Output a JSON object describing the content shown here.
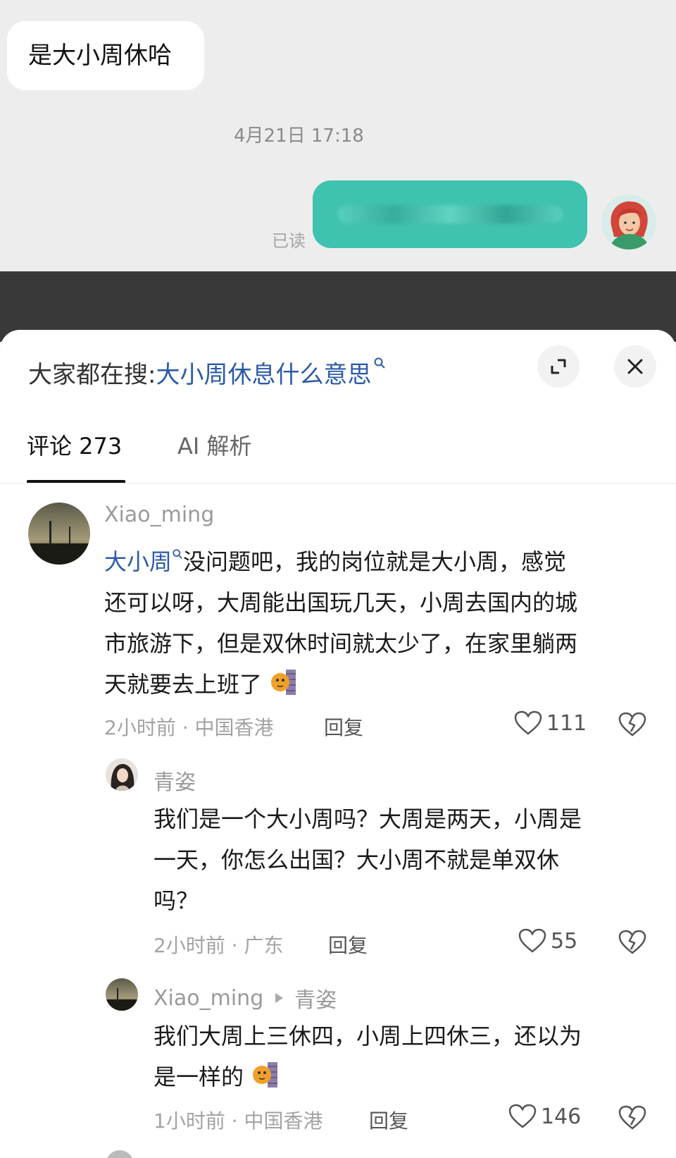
{
  "chat": {
    "incoming_message": "是大小周休哈",
    "timestamp": "4月21日 17:18",
    "read_status": "已读",
    "colors": {
      "outgoing_bubble": "#3fc2b0",
      "background": "#ededed"
    }
  },
  "sheet": {
    "search_prefix": "大家都在搜:",
    "search_query": "大小周休息什么意思",
    "expand_icon": "expand-icon",
    "close_icon": "close-icon"
  },
  "tabs": [
    {
      "label": "评论 273",
      "active": true
    },
    {
      "label": "AI 解析",
      "active": false
    }
  ],
  "comments": [
    {
      "user": "Xiao_ming",
      "link_text": "大小周",
      "lines": [
        "没问题吧，我的岗位就是大小周，感觉",
        "还可以呀，大周能出国玩几天，小周去国内的城",
        "市旅游下，但是双休时间就太少了，在家里躺两",
        "天就要去上班了"
      ],
      "time_location": "2小时前 · 中国香港",
      "reply_label": "回复",
      "likes": "111"
    },
    {
      "user": "青姿",
      "lines": [
        "我们是一个大小周吗？大周是两天，小周是",
        "一天，你怎么出国？大小周不就是单双休",
        "吗？"
      ],
      "time_location": "2小时前 · 广东",
      "reply_label": "回复",
      "likes": "55"
    },
    {
      "user": "Xiao_ming",
      "reply_to": "青姿",
      "lines": [
        "我们大周上三休四，小周上四休三，还以为",
        "是一样的"
      ],
      "time_location": "1小时前 · 中国香港",
      "reply_label": "回复",
      "likes": "146"
    }
  ]
}
